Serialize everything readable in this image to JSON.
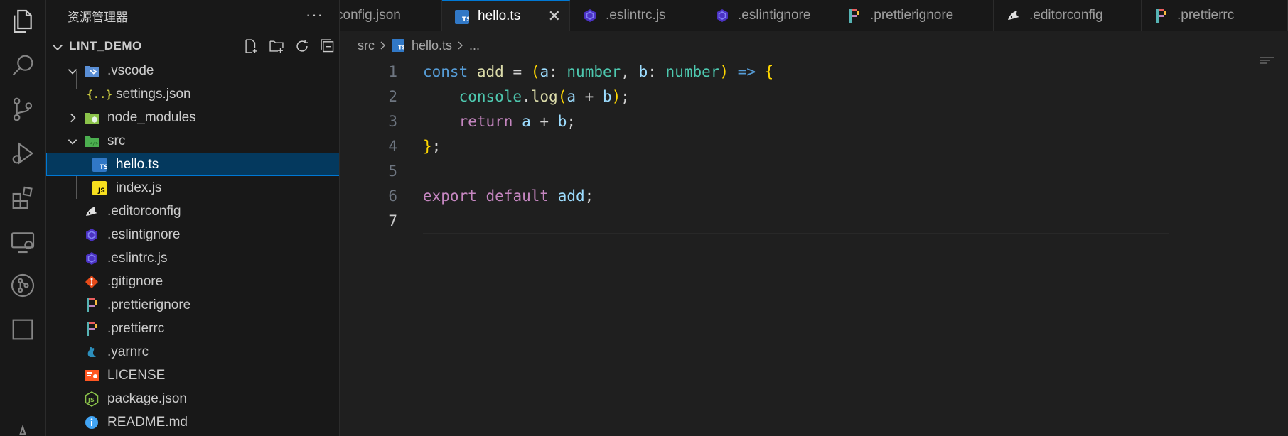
{
  "activity_bar": [
    {
      "name": "explorer-icon"
    },
    {
      "name": "search-icon"
    },
    {
      "name": "source-control-icon"
    },
    {
      "name": "run-debug-icon"
    },
    {
      "name": "extensions-icon"
    },
    {
      "name": "remote-explorer-icon"
    },
    {
      "name": "git-graph-icon"
    },
    {
      "name": "testing-icon"
    }
  ],
  "sidebar": {
    "title": "资源管理器",
    "more": "···",
    "project": "LINT_DEMO",
    "tree": [
      {
        "label": ".vscode",
        "depth": 1,
        "type": "folder-open",
        "icon": "vscode-folder-icon"
      },
      {
        "label": "settings.json",
        "depth": 2,
        "type": "file",
        "icon": "json-icon"
      },
      {
        "label": "node_modules",
        "depth": 1,
        "type": "folder-closed",
        "icon": "node-folder-icon"
      },
      {
        "label": "src",
        "depth": 1,
        "type": "folder-open",
        "icon": "src-folder-icon"
      },
      {
        "label": "hello.ts",
        "depth": 2,
        "type": "file",
        "icon": "typescript-icon",
        "selected": true
      },
      {
        "label": "index.js",
        "depth": 2,
        "type": "file",
        "icon": "javascript-icon"
      },
      {
        "label": ".editorconfig",
        "depth": 1,
        "type": "file",
        "icon": "editorconfig-icon"
      },
      {
        "label": ".eslintignore",
        "depth": 1,
        "type": "file",
        "icon": "eslint-icon"
      },
      {
        "label": ".eslintrc.js",
        "depth": 1,
        "type": "file",
        "icon": "eslint-icon"
      },
      {
        "label": ".gitignore",
        "depth": 1,
        "type": "file",
        "icon": "git-icon"
      },
      {
        "label": ".prettierignore",
        "depth": 1,
        "type": "file",
        "icon": "prettier-icon"
      },
      {
        "label": ".prettierrc",
        "depth": 1,
        "type": "file",
        "icon": "prettier-icon"
      },
      {
        "label": ".yarnrc",
        "depth": 1,
        "type": "file",
        "icon": "yarn-icon"
      },
      {
        "label": "LICENSE",
        "depth": 1,
        "type": "file",
        "icon": "license-icon"
      },
      {
        "label": "package.json",
        "depth": 1,
        "type": "file",
        "icon": "nodejs-icon"
      },
      {
        "label": "README.md",
        "depth": 1,
        "type": "file",
        "icon": "info-icon"
      }
    ]
  },
  "tabs": [
    {
      "label": "config.json",
      "icon": "",
      "active": false
    },
    {
      "label": "hello.ts",
      "icon": "typescript-icon",
      "active": true,
      "close": "✕"
    },
    {
      "label": ".eslintrc.js",
      "icon": "eslint-icon",
      "active": false
    },
    {
      "label": ".eslintignore",
      "icon": "eslint-icon",
      "active": false
    },
    {
      "label": ".prettierignore",
      "icon": "prettier-icon",
      "active": false
    },
    {
      "label": ".editorconfig",
      "icon": "editorconfig-icon",
      "active": false
    },
    {
      "label": ".prettierrc",
      "icon": "prettier-icon",
      "active": false
    }
  ],
  "breadcrumb": {
    "folder": "src",
    "file": "hello.ts",
    "symbol": "..."
  },
  "editor": {
    "current_line": 7,
    "line_numbers": [
      "1",
      "2",
      "3",
      "4",
      "5",
      "6",
      "7"
    ],
    "lines": [
      "const add = (a: number, b: number) => {",
      "    console.log(a + b);",
      "    return a + b;",
      "};",
      "",
      "export default add;",
      ""
    ]
  },
  "colors": {
    "accent": "#0078d4",
    "selection": "#04395e",
    "keyword": "#569cd6",
    "control": "#c586c0",
    "type": "#4ec9b0",
    "function": "#dcdcaa",
    "variable": "#9cdcfe",
    "bracket": "#ffd700"
  }
}
